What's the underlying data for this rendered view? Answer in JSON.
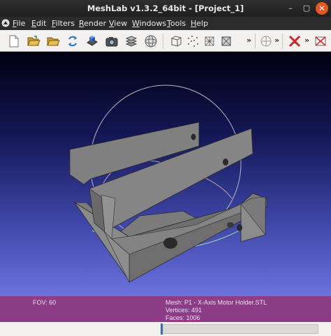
{
  "window": {
    "title": "MeshLab v1.3.2_64bit - [Project_1]",
    "minimize": "–",
    "maximize": "▢",
    "close": "✕"
  },
  "menu": [
    {
      "label": "File",
      "accel": "F",
      "rest": "ile"
    },
    {
      "label": "Edit",
      "accel": "E",
      "rest": "dit"
    },
    {
      "label": "Filters",
      "accel": "F",
      "rest": "ilters"
    },
    {
      "label": "Render",
      "accel": "R",
      "rest": "ender"
    },
    {
      "label": "View",
      "accel": "V",
      "rest": "iew"
    },
    {
      "label": "Windows",
      "accel": "W",
      "rest": "indows"
    },
    {
      "label": "Tools",
      "accel": "T",
      "rest": "ools"
    },
    {
      "label": "Help",
      "accel": "H",
      "rest": "elp"
    }
  ],
  "toolbar": {
    "icons": [
      "new-project-icon",
      "open-project-icon",
      "import-mesh-icon",
      "reload-icon",
      "export-mesh-icon",
      "snapshot-icon",
      "layers-icon",
      "sphere-icon",
      "bounding-box-icon",
      "points-icon",
      "wireframe-icon",
      "flat-lines-icon",
      "trackball-icon",
      "delete-icon",
      "select-faces-icon"
    ],
    "overflow": "»"
  },
  "info": {
    "fov": "FOV: 60",
    "mesh": "Mesh: P1 - X-Axis Motor Holder.STL",
    "vertices": "Vertices: 491",
    "faces": "Faces: 1006"
  },
  "colors": {
    "info_bar": "#8c3d86",
    "viewport_top": "#000010",
    "viewport_bottom": "#6b72de",
    "model": "#7d7d7d"
  }
}
